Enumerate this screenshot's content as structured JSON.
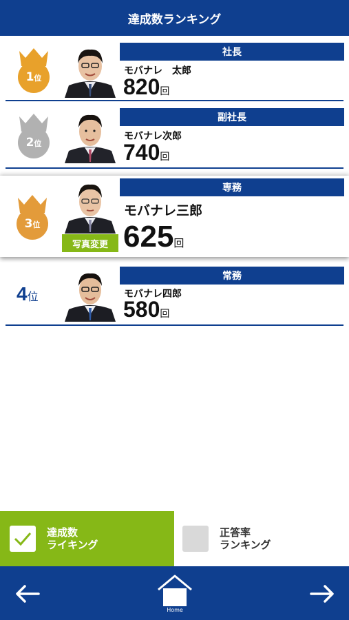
{
  "header": {
    "title": "達成数ランキング"
  },
  "rows": [
    {
      "rank": "1",
      "rank_suffix": "位",
      "medal_color": "#e8a12b",
      "title": "社長",
      "name": "モバナレ　太郎",
      "count": "820",
      "unit": "回"
    },
    {
      "rank": "2",
      "rank_suffix": "位",
      "medal_color": "#b1b1b1",
      "title": "副社長",
      "name": "モバナレ次郎",
      "count": "740",
      "unit": "回"
    },
    {
      "rank": "3",
      "rank_suffix": "位",
      "medal_color": "#e39b3a",
      "title": "専務",
      "name": "モバナレ三郎",
      "count": "625",
      "unit": "回",
      "photo_button": "写真変更"
    },
    {
      "rank": "4",
      "rank_suffix": "位",
      "title": "常務",
      "name": "モバナレ四郎",
      "count": "580",
      "unit": "回"
    }
  ],
  "toggles": {
    "achievement": {
      "label": "達成数\nライキング",
      "checked": true
    },
    "accuracy": {
      "label": "正答率\nランキング",
      "checked": false
    }
  },
  "footer": {
    "back_icon": "arrow-left-icon",
    "home_icon": "home-icon",
    "home_label": "Home",
    "forward_icon": "arrow-right-icon"
  },
  "colors": {
    "brand_blue": "#0f3f8f",
    "accent_green": "#86b817"
  }
}
